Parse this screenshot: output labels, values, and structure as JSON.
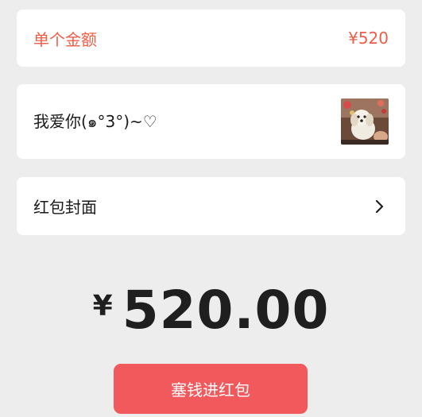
{
  "amount_row": {
    "label": "单个金额",
    "value": "¥520"
  },
  "greeting_row": {
    "text": "我爱你(๑°3°)~♡",
    "thumbnail_icon": "dog-photo-thumbnail"
  },
  "cover_row": {
    "label": "红包封面",
    "arrow_icon": "chevron-right-icon"
  },
  "total": {
    "currency": "¥",
    "amount": "520.00"
  },
  "submit": {
    "label": "塞钱进红包"
  },
  "colors": {
    "accent_red": "#f25c45",
    "button_red": "#f2595c",
    "background": "#ededed"
  }
}
